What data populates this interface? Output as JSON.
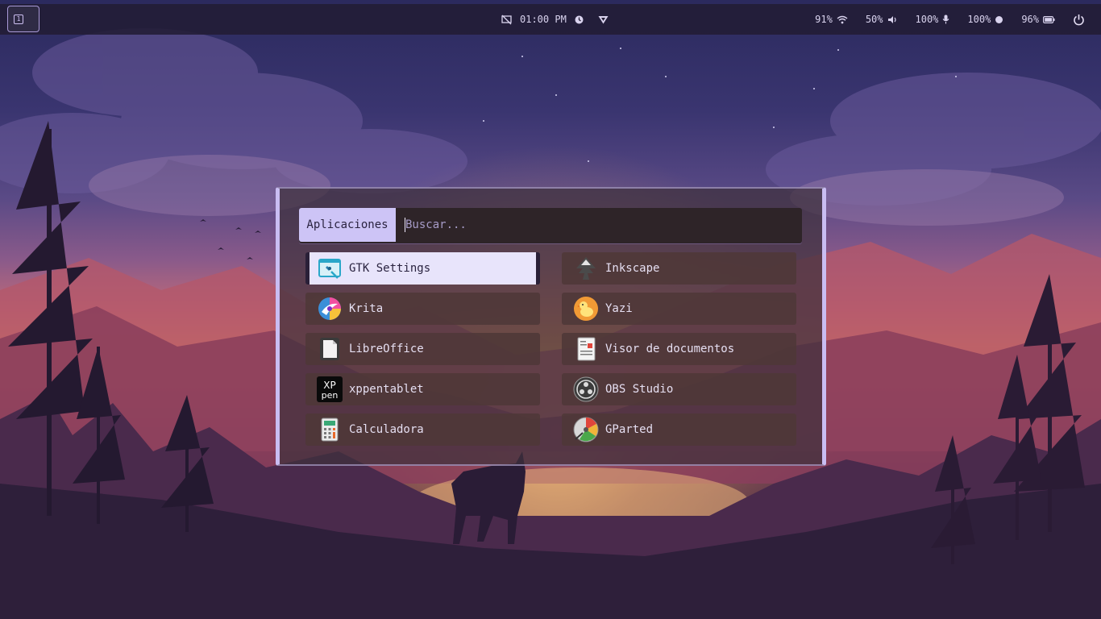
{
  "topbar": {
    "workspace_icon": "workspace-indicator-icon",
    "clock": "01:00 PM",
    "center_icons": [
      "screen-share-off-icon",
      "clock-icon",
      "vpn-shield-icon"
    ],
    "wifi_level": "91%",
    "volume_level": "50%",
    "mic_level": "100%",
    "brightness_level": "100%",
    "battery_level": "96%"
  },
  "launcher": {
    "mode_label": "Aplicaciones",
    "search_placeholder": "Buscar...",
    "search_value": "",
    "apps": [
      {
        "label": "GTK Settings",
        "icon": "gtk-settings-icon",
        "selected": true
      },
      {
        "label": "Inkscape",
        "icon": "inkscape-icon",
        "selected": false
      },
      {
        "label": "Krita",
        "icon": "krita-icon",
        "selected": false
      },
      {
        "label": "Yazi",
        "icon": "yazi-icon",
        "selected": false
      },
      {
        "label": "LibreOffice",
        "icon": "libreoffice-icon",
        "selected": false
      },
      {
        "label": "Visor de documentos",
        "icon": "document-viewer-icon",
        "selected": false
      },
      {
        "label": "xppentablet",
        "icon": "xppen-icon",
        "selected": false
      },
      {
        "label": "OBS Studio",
        "icon": "obs-studio-icon",
        "selected": false
      },
      {
        "label": "Calculadora",
        "icon": "calculator-icon",
        "selected": false
      },
      {
        "label": "GParted",
        "icon": "gparted-icon",
        "selected": false
      }
    ]
  },
  "xppen_icon_text": {
    "line1": "XP",
    "line2": "pen"
  },
  "colors": {
    "accent": "#cdc4f6",
    "panel_bg": "#221c34",
    "item_bg": "#4e3838",
    "selected_bg": "#e8e4fb"
  }
}
